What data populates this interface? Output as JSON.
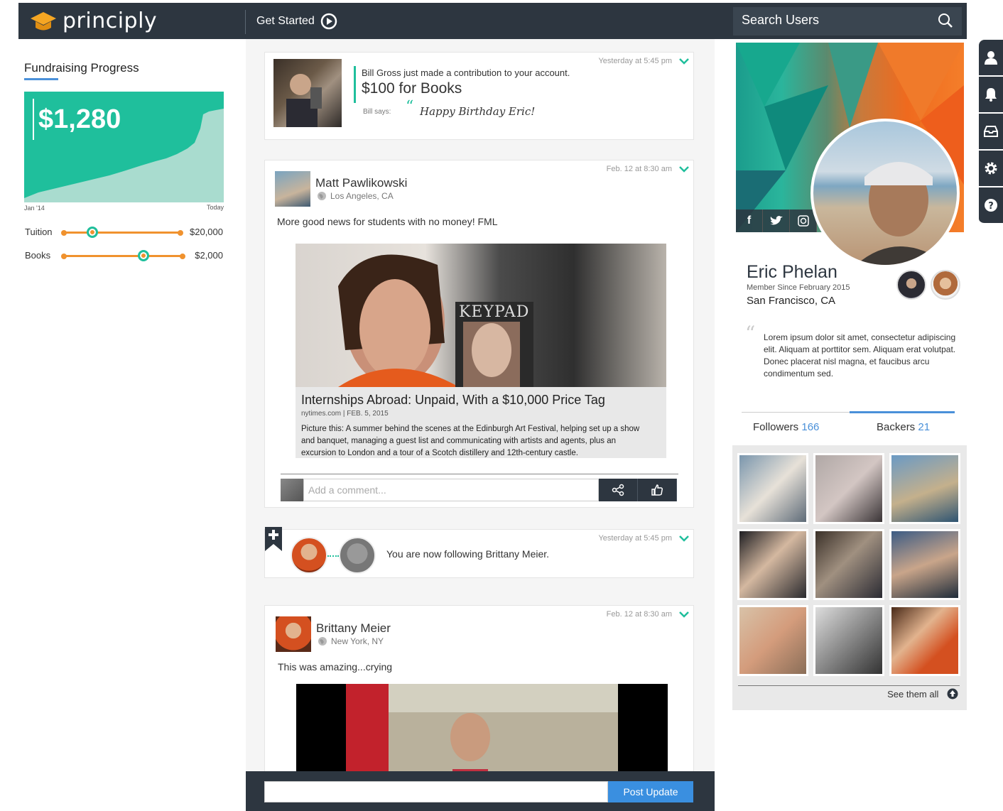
{
  "app": {
    "brand": "principly",
    "get_started": "Get Started",
    "search_placeholder": "Search Users"
  },
  "colors": {
    "nav_bg": "#2d3640",
    "teal": "#1fbf9c",
    "orange": "#f0922e",
    "blue": "#4a90d9",
    "brand_orange": "#f5a623"
  },
  "side_nav": [
    "profile-icon",
    "bell-icon",
    "inbox-icon",
    "gear-icon",
    "help-icon"
  ],
  "fundraising": {
    "title": "Fundraising Progress",
    "amount": "$1,280",
    "x_start": "Jan '14",
    "x_end": "Today",
    "goals": [
      {
        "label": "Tuition",
        "value": "$20,000",
        "progress": 0.2
      },
      {
        "label": "Books",
        "value": "$2,000",
        "progress": 0.69
      }
    ]
  },
  "feed": {
    "contribution": {
      "timestamp": "Yesterday at 5:45 pm",
      "message": "Bill Gross just made a contribution to your account.",
      "amount_text": "$100 for Books",
      "says_label": "Bill says:",
      "says_text": "Happy Birthday Eric!"
    },
    "post1": {
      "timestamp": "Feb. 12 at 8:30 am",
      "author": "Matt Pawlikowski",
      "location": "Los Angeles, CA",
      "text": "More good news for students with no money! FML",
      "image_text": "KEYPAD",
      "link_title": "Internships Abroad: Unpaid, With a $10,000 Price Tag",
      "link_source": "nytimes.com | FEB. 5, 2015",
      "link_desc": "Picture this: A summer behind the scenes at the Edinburgh Art Festival, helping set up a show and banquet, managing a guest list and communicating with artists and agents, plus an excursion to London and a tour of a Scotch distillery and 12th-century castle.",
      "comment_placeholder": "Add a comment..."
    },
    "follow": {
      "timestamp": "Yesterday at 5:45 pm",
      "text": "You are now following Brittany Meier."
    },
    "post2": {
      "timestamp": "Feb. 12 at 8:30 am",
      "author": "Brittany Meier",
      "location": "New York, NY",
      "text": "This was amazing...crying"
    },
    "post_button": "Post Update"
  },
  "profile": {
    "name": "Eric Phelan",
    "member_since": "Member Since February 2015",
    "city": "San Francisco, CA",
    "bio": "Lorem ipsum dolor sit amet, consectetur adipiscing elit. Aliquam at porttitor sem. Aliquam erat volutpat. Donec placerat nisl magna, et faucibus arcu condimentum sed.",
    "followers_label": "Followers",
    "followers_count": "166",
    "backers_label": "Backers",
    "backers_count": "21",
    "see_all": "See them all"
  }
}
